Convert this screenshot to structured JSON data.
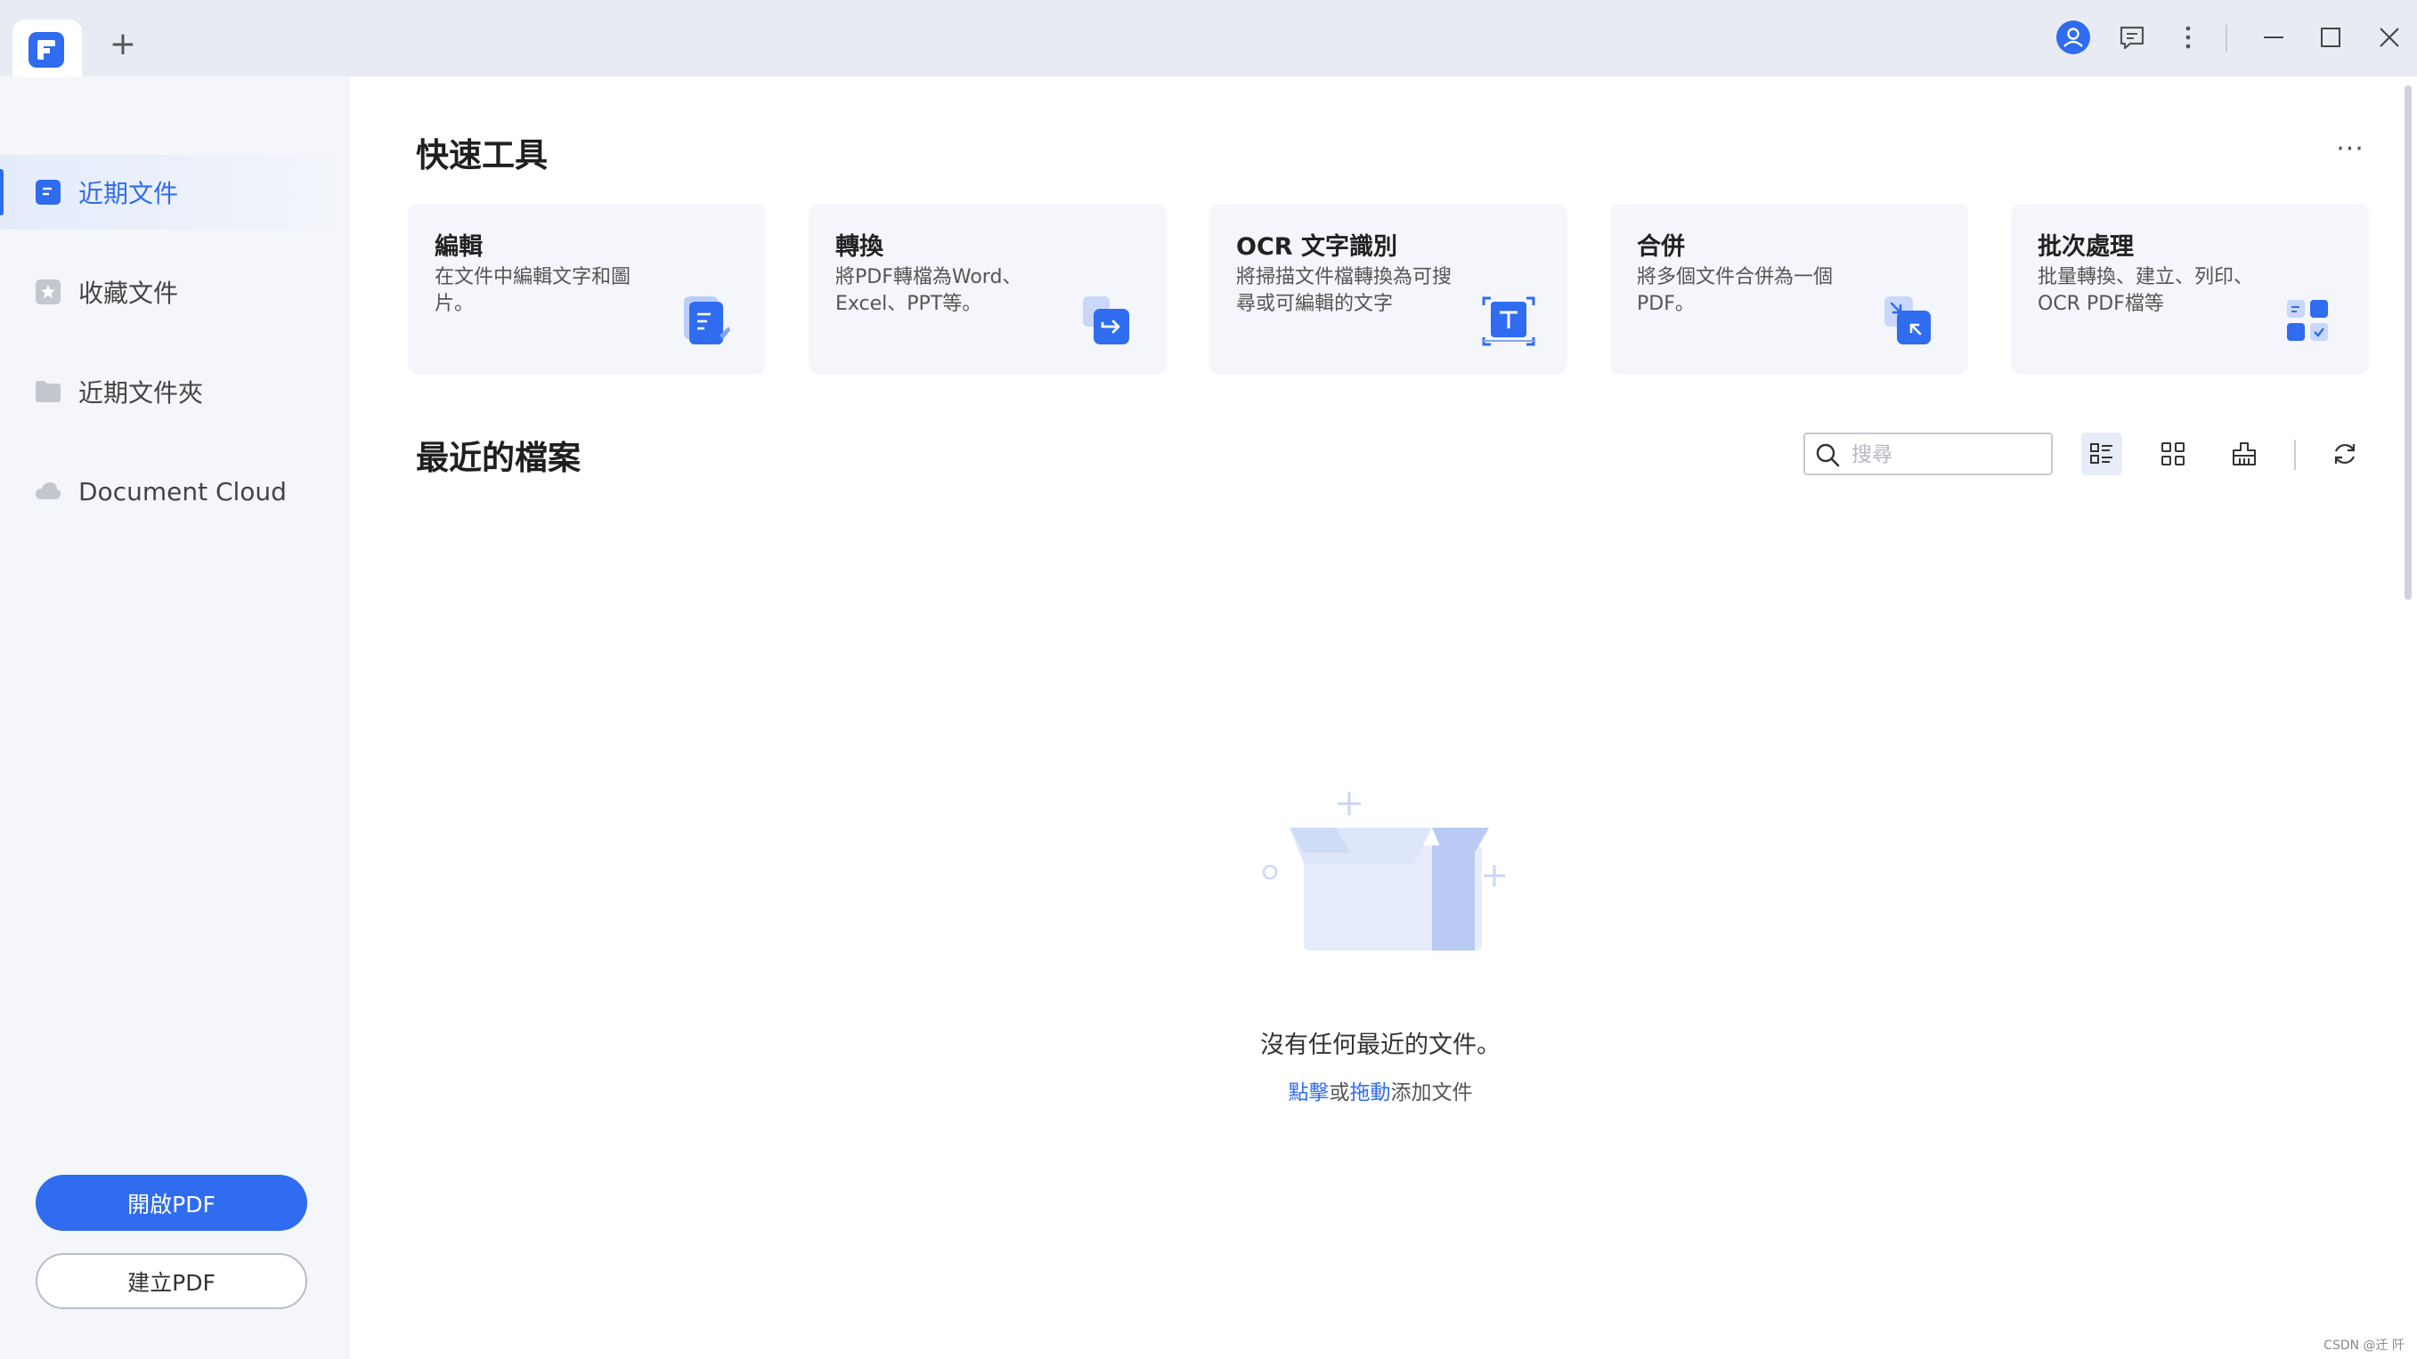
{
  "titlebar": {
    "new_tab_symbol": "+",
    "icons": [
      "account-icon",
      "feedback-icon",
      "more-vertical-icon",
      "minimize-icon",
      "maximize-icon",
      "close-icon"
    ]
  },
  "sidebar": {
    "items": [
      {
        "label": "近期文件",
        "icon": "recent-file-icon",
        "active": true
      },
      {
        "label": "收藏文件",
        "icon": "star-file-icon",
        "active": false
      },
      {
        "label": "近期文件夾",
        "icon": "folder-icon",
        "active": false
      },
      {
        "label": "Document Cloud",
        "icon": "cloud-icon",
        "active": false
      }
    ],
    "open_pdf_label": "開啟PDF",
    "create_pdf_label": "建立PDF"
  },
  "quick_tools": {
    "title": "快速工具",
    "more_symbol": "···",
    "cards": [
      {
        "title": "編輯",
        "desc": "在文件中編輯文字和圖片。",
        "icon": "edit-icon"
      },
      {
        "title": "轉換",
        "desc": "將PDF轉檔為Word、Excel、PPT等。",
        "icon": "convert-icon"
      },
      {
        "title": "OCR 文字識別",
        "desc": "將掃描文件檔轉換為可搜尋或可編輯的文字",
        "icon": "ocr-icon"
      },
      {
        "title": "合併",
        "desc": "將多個文件合併為一個PDF。",
        "icon": "merge-icon"
      },
      {
        "title": "批次處理",
        "desc": "批量轉換、建立、列印、OCR PDF檔等",
        "icon": "batch-icon"
      }
    ]
  },
  "recent": {
    "title": "最近的檔案",
    "search_placeholder": "搜尋",
    "empty_message": "沒有任何最近的文件。",
    "click_label": "點擊",
    "or_label": "或",
    "drag_label": "拖動",
    "add_label": "添加文件"
  },
  "watermark": "CSDN @迁 阡",
  "colors": {
    "accent": "#2f6cf0",
    "sidebar_bg": "#f4f6fa",
    "titlebar_bg": "#e8ebf2",
    "card_bg": "#f4f6fb"
  }
}
